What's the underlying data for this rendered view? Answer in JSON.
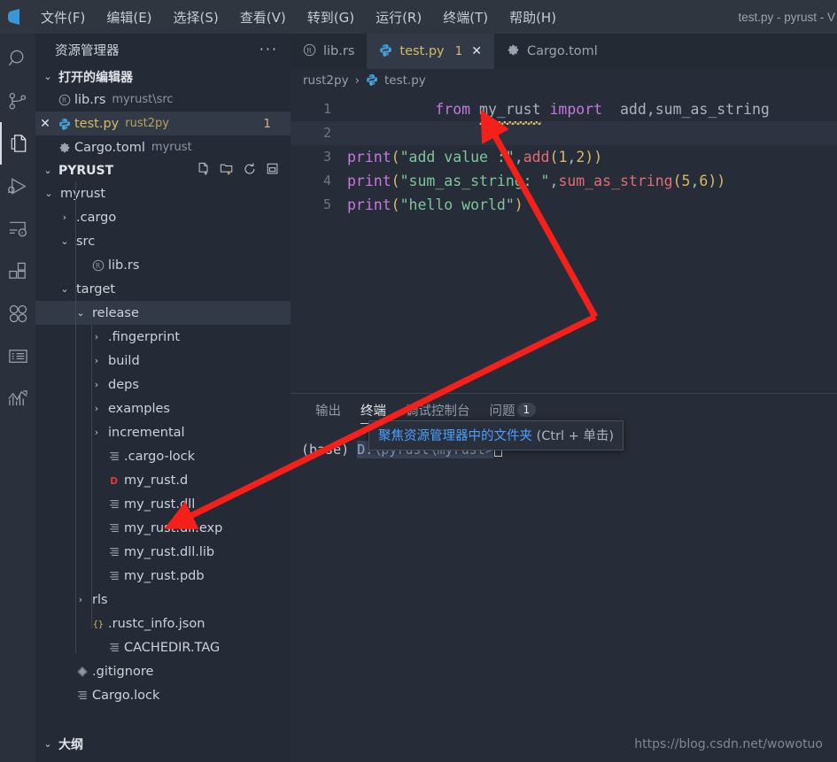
{
  "window": {
    "title": "test.py - pyrust - V"
  },
  "menubar": {
    "items": [
      {
        "label": "文件(F)",
        "name": "menu-file"
      },
      {
        "label": "编辑(E)",
        "name": "menu-edit"
      },
      {
        "label": "选择(S)",
        "name": "menu-selection"
      },
      {
        "label": "查看(V)",
        "name": "menu-view"
      },
      {
        "label": "转到(G)",
        "name": "menu-goto"
      },
      {
        "label": "运行(R)",
        "name": "menu-run"
      },
      {
        "label": "终端(T)",
        "name": "menu-terminal"
      },
      {
        "label": "帮助(H)",
        "name": "menu-help"
      }
    ]
  },
  "activitybar": {
    "items": [
      {
        "icon": "search-icon",
        "active": false
      },
      {
        "icon": "source-control-icon",
        "active": false
      },
      {
        "icon": "explorer-files-icon",
        "active": true
      },
      {
        "icon": "run-and-debug-icon",
        "active": false
      },
      {
        "icon": "remote-explorer-icon",
        "active": false
      },
      {
        "icon": "extensions-icon",
        "active": false
      },
      {
        "icon": "testing-beaker-icon",
        "active": false
      },
      {
        "icon": "list-panel-icon",
        "active": false
      },
      {
        "icon": "chart-analytics-icon",
        "active": false
      }
    ]
  },
  "sidebar": {
    "title": "资源管理器",
    "more_actions": "···",
    "open_editors": {
      "label": "打开的编辑器",
      "items": [
        {
          "close": "",
          "icon": "rust-file-icon",
          "name": "lib.rs",
          "desc": "myrust\\src",
          "badge": "",
          "selected": false,
          "yellow": false
        },
        {
          "close": "✕",
          "icon": "python-file-icon",
          "name": "test.py",
          "desc": "rust2py",
          "badge": "1",
          "selected": true,
          "yellow": true
        },
        {
          "close": "",
          "icon": "gear-file-icon",
          "name": "Cargo.toml",
          "desc": "myrust",
          "badge": "",
          "selected": false,
          "yellow": false
        }
      ]
    },
    "project": {
      "label": "PYRUST",
      "actions": [
        "new-file-icon",
        "new-folder-icon",
        "refresh-icon",
        "collapse-all-icon"
      ],
      "tree": [
        {
          "depth": 1,
          "twisty": "chevron-down",
          "icon": "",
          "name": "myrust",
          "selected": false
        },
        {
          "depth": 2,
          "twisty": "chevron-right",
          "icon": "",
          "name": ".cargo",
          "selected": false
        },
        {
          "depth": 2,
          "twisty": "chevron-down",
          "icon": "",
          "name": "src",
          "selected": false
        },
        {
          "depth": 3,
          "twisty": "none",
          "icon": "rust-file-icon",
          "name": "lib.rs",
          "selected": false
        },
        {
          "depth": 2,
          "twisty": "chevron-down",
          "icon": "",
          "name": "target",
          "selected": false
        },
        {
          "depth": 3,
          "twisty": "chevron-down",
          "icon": "",
          "name": "release",
          "selected": true
        },
        {
          "depth": 4,
          "twisty": "chevron-right",
          "icon": "",
          "name": ".fingerprint",
          "selected": false
        },
        {
          "depth": 4,
          "twisty": "chevron-right",
          "icon": "",
          "name": "build",
          "selected": false
        },
        {
          "depth": 4,
          "twisty": "chevron-right",
          "icon": "",
          "name": "deps",
          "selected": false
        },
        {
          "depth": 4,
          "twisty": "chevron-right",
          "icon": "",
          "name": "examples",
          "selected": false
        },
        {
          "depth": 4,
          "twisty": "chevron-right",
          "icon": "",
          "name": "incremental",
          "selected": false
        },
        {
          "depth": 4,
          "twisty": "none",
          "icon": "text-file-icon",
          "name": ".cargo-lock",
          "selected": false
        },
        {
          "depth": 4,
          "twisty": "none",
          "icon": "d-file-icon",
          "name": "my_rust.d",
          "selected": false
        },
        {
          "depth": 4,
          "twisty": "none",
          "icon": "text-file-icon",
          "name": "my_rust.dll",
          "selected": false
        },
        {
          "depth": 4,
          "twisty": "none",
          "icon": "text-file-icon",
          "name": "my_rust.dll.exp",
          "selected": false
        },
        {
          "depth": 4,
          "twisty": "none",
          "icon": "text-file-icon",
          "name": "my_rust.dll.lib",
          "selected": false
        },
        {
          "depth": 4,
          "twisty": "none",
          "icon": "text-file-icon",
          "name": "my_rust.pdb",
          "selected": false
        },
        {
          "depth": 3,
          "twisty": "chevron-right",
          "icon": "",
          "name": "rls",
          "selected": false
        },
        {
          "depth": 3,
          "twisty": "none",
          "icon": "json-file-icon",
          "name": ".rustc_info.json",
          "selected": false
        },
        {
          "depth": 4,
          "twisty": "none",
          "icon": "text-file-icon",
          "name": "CACHEDIR.TAG",
          "selected": false
        },
        {
          "depth": 2,
          "twisty": "none",
          "icon": "git-file-icon",
          "name": ".gitignore",
          "selected": false
        },
        {
          "depth": 2,
          "twisty": "none",
          "icon": "text-file-icon",
          "name": "Cargo.lock",
          "selected": false
        }
      ]
    },
    "outline": {
      "label": "大纲"
    }
  },
  "editor": {
    "tabs": [
      {
        "icon": "rust-file-icon",
        "label": "lib.rs",
        "badge": "",
        "close": "",
        "active": false
      },
      {
        "icon": "python-file-icon",
        "label": "test.py",
        "badge": "1",
        "close": "✕",
        "active": true
      },
      {
        "icon": "gear-file-icon",
        "label": "Cargo.toml",
        "badge": "",
        "close": "",
        "active": false
      }
    ],
    "breadcrumb": {
      "root": "rust2py",
      "separator": "›",
      "file": "test.py",
      "file_icon": "python-file-icon"
    },
    "lines": [
      {
        "n": "1",
        "current": false
      },
      {
        "n": "2",
        "current": true
      },
      {
        "n": "3",
        "current": false
      },
      {
        "n": "4",
        "current": false
      },
      {
        "n": "5",
        "current": false
      }
    ],
    "code": {
      "l1_from": "from ",
      "l1_module": "my_rust",
      "l1_import": " import ",
      "l1_names": " add,sum_as_string",
      "l3_print": "print",
      "l3_str": "\"add value :\"",
      "l3_fn": "add",
      "l3_a": "1",
      "l3_b": "2",
      "l4_print": "print",
      "l4_str": "\"sum_as_string: \"",
      "l4_fn": "sum_as_string",
      "l4_a": "5",
      "l4_b": "6",
      "l5_print": "print",
      "l5_str": "\"hello world\""
    }
  },
  "panel": {
    "tabs": [
      {
        "label": "输出",
        "active": false,
        "badge": ""
      },
      {
        "label": "终端",
        "active": true,
        "badge": ""
      },
      {
        "label": "调试控制台",
        "active": false,
        "badge": ""
      },
      {
        "label": "问题",
        "active": false,
        "badge": "1"
      }
    ],
    "terminal": {
      "env": "(base)",
      "path": "D:\\pyrust\\myrust>"
    },
    "tooltip": {
      "link": "聚焦资源管理器中的文件夹",
      "hint": "(Ctrl + 单击)"
    }
  },
  "watermark": "https://blog.csdn.net/wowotuo",
  "colors": {
    "accent_yellow": "#d7b963",
    "annotation_red": "#f42019",
    "tooltip_link": "#4a9eff",
    "titlebar_bg": "#2f3640",
    "sidebar_bg": "#252b36",
    "editor_bg": "#272d38"
  }
}
